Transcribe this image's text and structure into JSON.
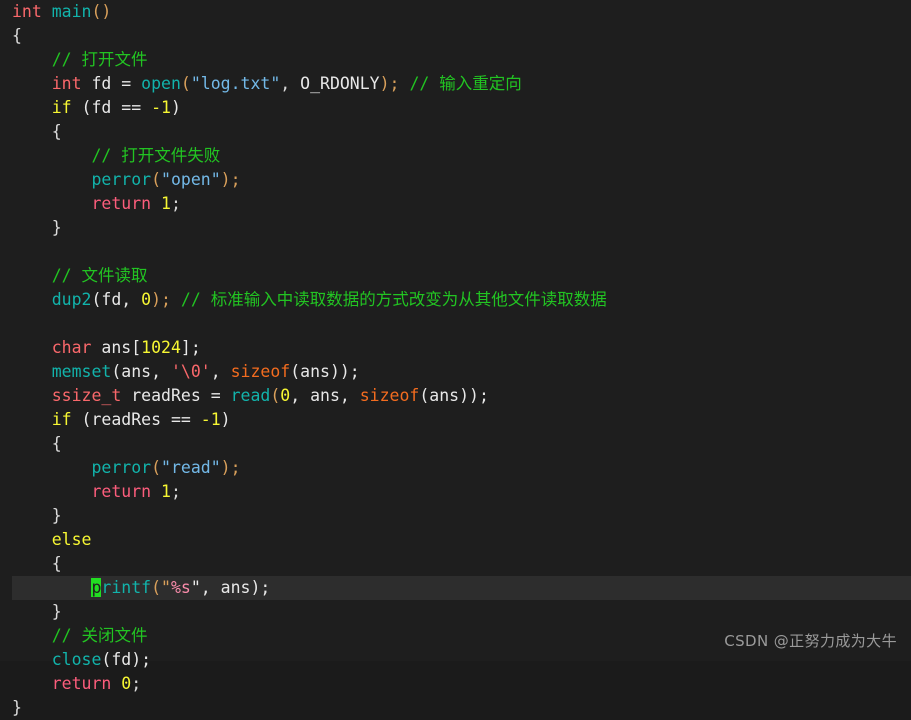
{
  "editor": {
    "background_color": "#1e1e1e",
    "highlight_line_color": "#2d2d2d",
    "cursor_color": "#22dd22",
    "language": "C"
  },
  "code": {
    "l01_int": "int",
    "l01_main": "main",
    "l01_parens": "()",
    "l02_brace": "{",
    "l03_comment": "// 打开文件",
    "l04_int": "int",
    "l04_fd": " fd = ",
    "l04_open": "open",
    "l04_paren_open": "(",
    "l04_string": "\"log.txt\"",
    "l04_comma": ", ",
    "l04_flag": "O_RDONLY",
    "l04_close": ");",
    "l04_comment": "// 输入重定向",
    "l05_if": "if",
    "l05_cond_a": " (fd == ",
    "l05_num": "-1",
    "l05_cond_b": ")",
    "l06_brace": "{",
    "l07_comment": "// 打开文件失败",
    "l08_perror": "perror",
    "l08_paren_open": "(",
    "l08_string": "\"open\"",
    "l08_close": ");",
    "l09_return": "return",
    "l09_num": " 1",
    "l09_semi": ";",
    "l10_brace": "}",
    "l12_comment": "// 文件读取",
    "l13_dup2": "dup2",
    "l13_args": "(fd, ",
    "l13_num": "0",
    "l13_close": ");",
    "l13_comment": "// 标准输入中读取数据的方式改变为从其他文件读取数据",
    "l15_char": "char",
    "l15_name": " ans[",
    "l15_num": "1024",
    "l15_close": "];",
    "l16_memset": "memset",
    "l16_a": "(ans, ",
    "l16_chr": "'\\0'",
    "l16_b": ", ",
    "l16_sizeof": "sizeof",
    "l16_c": "(ans));",
    "l17_type": "ssize_t",
    "l17_name": " readRes = ",
    "l17_read": "read",
    "l17_a": "(",
    "l17_num": "0",
    "l17_b": ", ans, ",
    "l17_sizeof": "sizeof",
    "l17_c": "(ans));",
    "l18_if": "if",
    "l18_a": " (readRes == ",
    "l18_num": "-1",
    "l18_b": ")",
    "l19_brace": "{",
    "l20_perror": "perror",
    "l20_a": "(",
    "l20_string": "\"read\"",
    "l20_b": ");",
    "l21_return": "return",
    "l21_num": " 1",
    "l21_semi": ";",
    "l22_brace": "}",
    "l23_else": "else",
    "l24_brace": "{",
    "l25_cursor_char": "p",
    "l25_printf_rest": "rintf",
    "l25_a": "(\"",
    "l25_fmt": "%s",
    "l25_b": "\", ans);",
    "l26_brace": "}",
    "l27_comment": "// 关闭文件",
    "l28_close": "close",
    "l28_a": "(fd);",
    "l29_return": "return",
    "l29_num": " 0",
    "l29_semi": ";",
    "l30_brace": "}"
  },
  "watermark": {
    "text": "CSDN @正努力成为大牛"
  }
}
